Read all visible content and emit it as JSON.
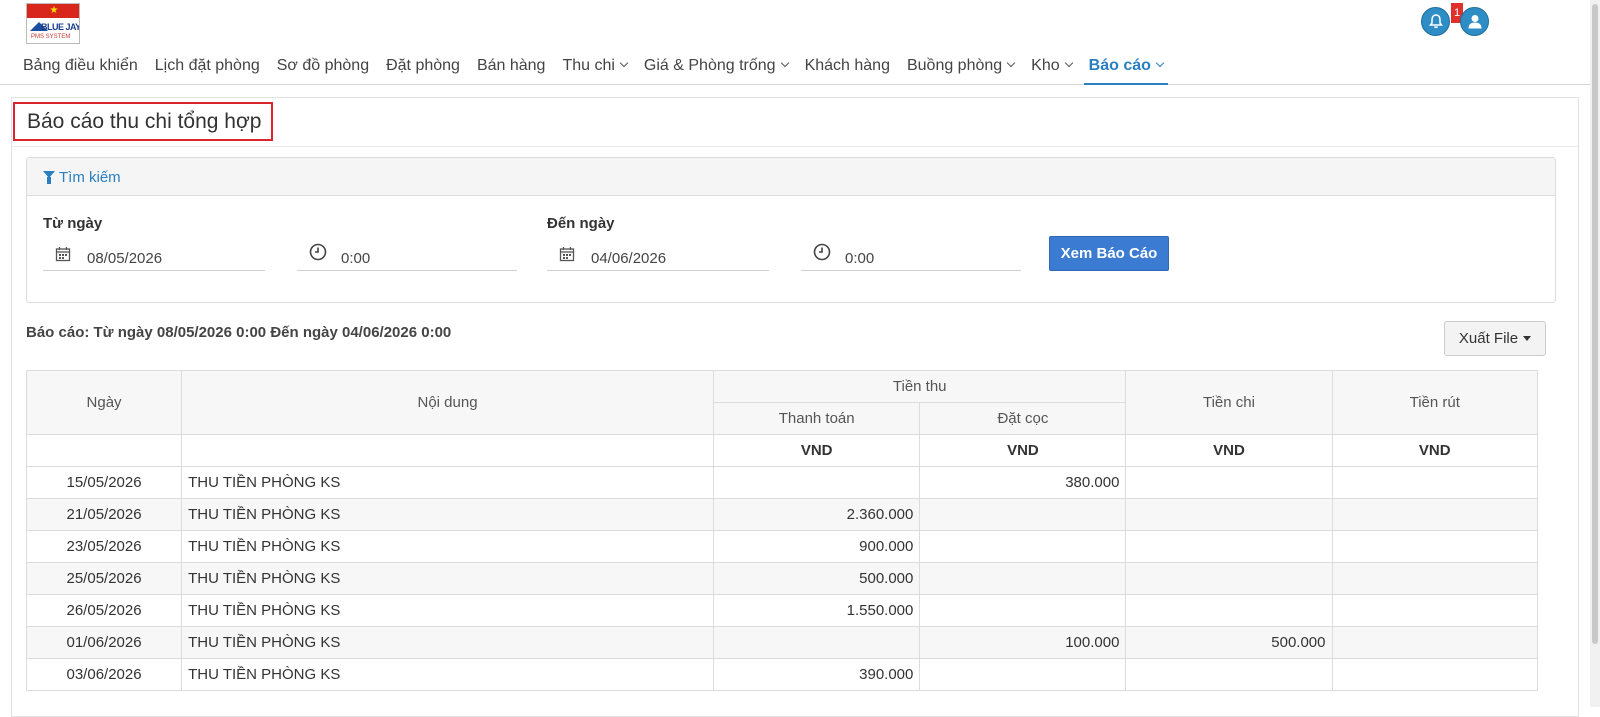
{
  "logo": {
    "line1": "BLUE JAY",
    "line2": "PMS SYSTEM"
  },
  "notifications": {
    "count": "1"
  },
  "nav": [
    {
      "label": "Bảng điều khiển",
      "dropdown": false
    },
    {
      "label": "Lịch đặt phòng",
      "dropdown": false
    },
    {
      "label": "Sơ đồ phòng",
      "dropdown": false
    },
    {
      "label": "Đặt phòng",
      "dropdown": false
    },
    {
      "label": "Bán hàng",
      "dropdown": false
    },
    {
      "label": "Thu chi",
      "dropdown": true
    },
    {
      "label": "Giá & Phòng trống",
      "dropdown": true
    },
    {
      "label": "Khách hàng",
      "dropdown": false
    },
    {
      "label": "Buồng phòng",
      "dropdown": true
    },
    {
      "label": "Kho",
      "dropdown": true
    },
    {
      "label": "Báo cáo",
      "dropdown": true,
      "active": true
    }
  ],
  "page": {
    "title": "Báo cáo thu chi tổng hợp"
  },
  "search": {
    "title": "Tìm kiếm",
    "from_label": "Từ ngày",
    "from_date": "08/05/2026",
    "from_time": "0:00",
    "to_label": "Đến ngày",
    "to_date": "04/06/2026",
    "to_time": "0:00",
    "submit_label": "Xem Báo Cáo"
  },
  "report": {
    "range_text": "Báo cáo: Từ ngày 08/05/2026 0:00 Đến ngày 04/06/2026 0:00",
    "export_label": "Xuất File"
  },
  "table": {
    "headers": {
      "date": "Ngày",
      "content": "Nội dung",
      "income": "Tiền thu",
      "payment": "Thanh toán",
      "deposit": "Đặt cọc",
      "expense": "Tiền chi",
      "withdraw": "Tiền rút",
      "unit": "VND"
    },
    "rows": [
      {
        "date": "15/05/2026",
        "content": "THU TIỀN PHÒNG KS",
        "payment": "",
        "deposit": "380.000",
        "expense": "",
        "withdraw": ""
      },
      {
        "date": "21/05/2026",
        "content": "THU TIỀN PHÒNG KS",
        "payment": "2.360.000",
        "deposit": "",
        "expense": "",
        "withdraw": ""
      },
      {
        "date": "23/05/2026",
        "content": "THU TIỀN PHÒNG KS",
        "payment": "900.000",
        "deposit": "",
        "expense": "",
        "withdraw": ""
      },
      {
        "date": "25/05/2026",
        "content": "THU TIỀN PHÒNG KS",
        "payment": "500.000",
        "deposit": "",
        "expense": "",
        "withdraw": ""
      },
      {
        "date": "26/05/2026",
        "content": "THU TIỀN PHÒNG KS",
        "payment": "1.550.000",
        "deposit": "",
        "expense": "",
        "withdraw": ""
      },
      {
        "date": "01/06/2026",
        "content": "THU TIỀN PHÒNG KS",
        "payment": "",
        "deposit": "100.000",
        "expense": "500.000",
        "withdraw": ""
      },
      {
        "date": "03/06/2026",
        "content": "THU TIỀN PHÒNG KS",
        "payment": "390.000",
        "deposit": "",
        "expense": "",
        "withdraw": ""
      }
    ]
  }
}
